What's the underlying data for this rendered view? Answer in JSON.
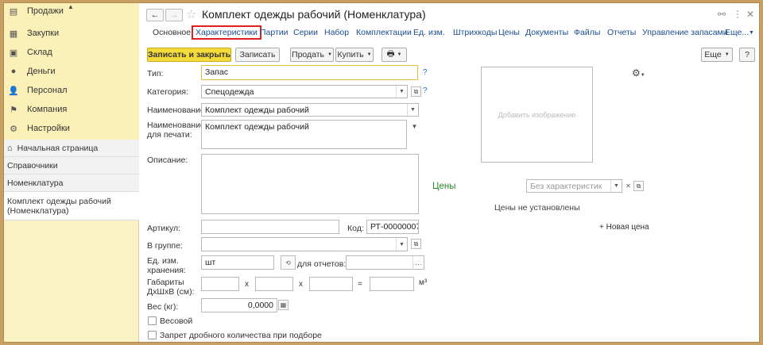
{
  "sidebar": {
    "sections": [
      {
        "label": "Продажи",
        "icon": "sales-icon"
      },
      {
        "label": "Закупки",
        "icon": "purchases-icon"
      },
      {
        "label": "Склад",
        "icon": "warehouse-icon"
      },
      {
        "label": "Деньги",
        "icon": "money-icon"
      },
      {
        "label": "Персонал",
        "icon": "staff-icon"
      },
      {
        "label": "Компания",
        "icon": "company-icon"
      },
      {
        "label": "Настройки",
        "icon": "settings-icon"
      }
    ],
    "open_windows": [
      {
        "label": "Начальная страница"
      },
      {
        "label": "Справочники"
      },
      {
        "label": "Номенклатура"
      },
      {
        "label": "Комплект одежды рабочий (Номенклатура)"
      }
    ]
  },
  "header": {
    "back": "←",
    "forward": "→",
    "star": "☆",
    "title": "Комплект одежды рабочий (Номенклатура)",
    "link_icon": "⚯",
    "more_icon": "⋮",
    "close_icon": "✕"
  },
  "tabs": [
    {
      "label": "Основное"
    },
    {
      "label": "Характеристики"
    },
    {
      "label": "Партии"
    },
    {
      "label": "Серии"
    },
    {
      "label": "Набор"
    },
    {
      "label": "Комплектации"
    },
    {
      "label": "Ед. изм."
    },
    {
      "label": "Штрихкоды"
    },
    {
      "label": "Цены"
    },
    {
      "label": "Документы"
    },
    {
      "label": "Файлы"
    },
    {
      "label": "Отчеты"
    },
    {
      "label": "Управление запасами"
    },
    {
      "label": "Еще..."
    }
  ],
  "toolbar": {
    "save_close": "Записать и закрыть",
    "save": "Записать",
    "sell": "Продать",
    "buy": "Купить",
    "print_icon": "🖶",
    "more": "Еще",
    "help": "?"
  },
  "form": {
    "type_label": "Тип:",
    "type_value": "Запас",
    "category_label": "Категория:",
    "category_value": "Спецодежда",
    "name_label": "Наименование:",
    "name_value": "Комплект одежды рабочий",
    "print_name_label_1": "Наименование",
    "print_name_label_2": "для печати:",
    "print_name_value": "Комплект одежды рабочий",
    "description_label": "Описание:",
    "description_value": "",
    "article_label": "Артикул:",
    "article_value": "",
    "code_label": "Код:",
    "code_value": "РТ-00000007",
    "group_label": "В группе:",
    "group_value": "",
    "unit_label_1": "Ед. изм.",
    "unit_label_2": "хранения:",
    "unit_value": "шт",
    "reports_label": "для отчетов:",
    "reports_value": "",
    "dims_label_1": "Габариты",
    "dims_label_2": "ДхШхВ (см):",
    "x1": "x",
    "x2": "x",
    "eq": "=",
    "m3": "м³",
    "weight_label": "Вес (кг):",
    "weight_value": "0,0000",
    "weighted_label": "Весовой",
    "fractional_label": "Запрет дробного количества при подборе",
    "help_q": "?",
    "image_placeholder": "Добавить изображение",
    "gear": "⚙",
    "prices_title": "Цены",
    "characteristic_placeholder": "Без характеристик",
    "no_prices": "Цены не установлены",
    "new_price": "+ Новая цена"
  },
  "colors": {
    "sidebar_bg": "#fbf0b8",
    "primary_button": "#f5db3a",
    "link": "#1a4d8f",
    "prices_green": "#2a8a2a",
    "highlight_red": "#e02020"
  }
}
